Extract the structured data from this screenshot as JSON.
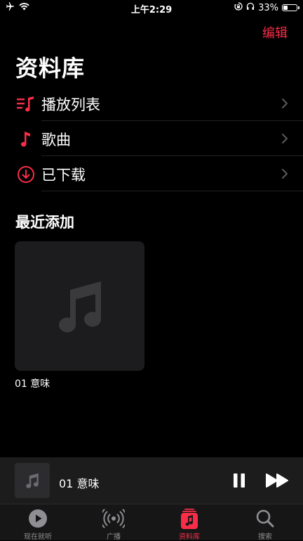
{
  "status_bar": {
    "time": "上午2:29",
    "battery_text": "33%",
    "battery_level": 0.33,
    "icons": [
      "airplane-icon",
      "wifi-icon",
      "orientation-lock-icon",
      "headphones-icon",
      "battery-icon"
    ]
  },
  "header": {
    "edit_label": "编辑",
    "title": "资料库"
  },
  "library": {
    "items": [
      {
        "label": "播放列表",
        "icon": "playlist-icon"
      },
      {
        "label": "歌曲",
        "icon": "music-note-icon"
      },
      {
        "label": "已下载",
        "icon": "download-circle-icon"
      }
    ]
  },
  "recently_added": {
    "title": "最近添加",
    "albums": [
      {
        "title": "01 意味",
        "icon": "music-note-placeholder-icon"
      }
    ]
  },
  "mini_player": {
    "title": "01 意味",
    "state": "playing"
  },
  "tabs": [
    {
      "label": "现在就听",
      "icon": "play-circle-icon",
      "active": false
    },
    {
      "label": "广播",
      "icon": "radio-icon",
      "active": false
    },
    {
      "label": "资料库",
      "icon": "library-icon",
      "active": true
    },
    {
      "label": "搜索",
      "icon": "search-icon",
      "active": false
    }
  ],
  "colors": {
    "accent": "#fa2d48",
    "background": "#000000",
    "inactive": "#8e8e93"
  }
}
